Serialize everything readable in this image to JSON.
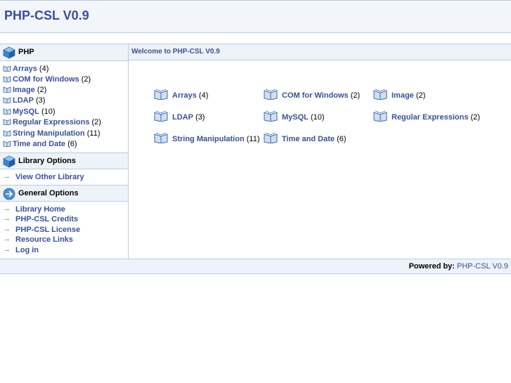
{
  "header": {
    "title": "PHP-CSL V0.9"
  },
  "sidebar": {
    "php_section": {
      "label": "PHP",
      "items": [
        {
          "label": "Arrays",
          "count": "(4)"
        },
        {
          "label": "COM for Windows",
          "count": "(2)"
        },
        {
          "label": "Image",
          "count": "(2)"
        },
        {
          "label": "LDAP",
          "count": "(3)"
        },
        {
          "label": "MySQL",
          "count": "(10)"
        },
        {
          "label": "Regular Expressions",
          "count": "(2)"
        },
        {
          "label": "String Manipulation",
          "count": "(11)"
        },
        {
          "label": "Time and Date",
          "count": "(6)"
        }
      ]
    },
    "library_options": {
      "label": "Library Options",
      "items": [
        {
          "label": "View Other Library"
        }
      ]
    },
    "general_options": {
      "label": "General Options",
      "items": [
        {
          "label": "Library Home"
        },
        {
          "label": "PHP-CSL Credits"
        },
        {
          "label": "PHP-CSL License"
        },
        {
          "label": "Resource Links"
        },
        {
          "label": "Log in"
        }
      ]
    }
  },
  "main": {
    "heading": "Welcome to PHP-CSL V0.9",
    "grid": [
      {
        "label": "Arrays",
        "count": "(4)"
      },
      {
        "label": "COM for Windows",
        "count": "(2)"
      },
      {
        "label": "Image",
        "count": "(2)"
      },
      {
        "label": "LDAP",
        "count": "(3)"
      },
      {
        "label": "MySQL",
        "count": "(10)"
      },
      {
        "label": "Regular Expressions",
        "count": "(2)"
      },
      {
        "label": "String Manipulation",
        "count": "(11)"
      },
      {
        "label": "Time and Date",
        "count": "(6)"
      }
    ]
  },
  "footer": {
    "prefix": "Powered by:",
    "link": "PHP-CSL V0.9"
  },
  "colors": {
    "link": "#3a4f9c",
    "arrow": "#3aa02a",
    "border": "#b8cde0",
    "header_bg": "#f2f6fb",
    "section_bg": "#eef3f9"
  },
  "icons": {
    "category": "book-icon",
    "php_section": "cube-icon",
    "library_options": "cube-icon",
    "general_options": "globe-icon",
    "link_arrow": "arrow-right-icon"
  }
}
